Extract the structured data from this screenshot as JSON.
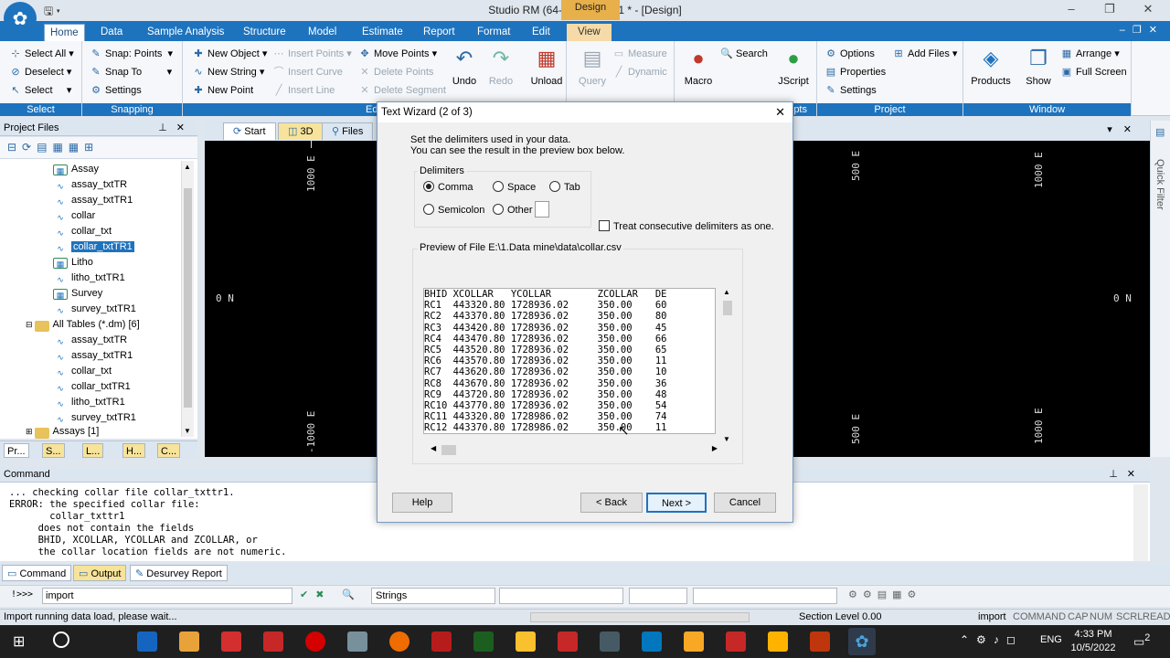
{
  "window": {
    "title": "Studio RM (64-bit) - aurum1 * - [Design]",
    "context_tab": "Design",
    "app_icon": "studio-rm-logo",
    "controls": [
      "–",
      "❐",
      "✕"
    ]
  },
  "ribbon": {
    "tabs": [
      "Home",
      "Data",
      "Sample Analysis",
      "Structure",
      "Model",
      "Estimate",
      "Report",
      "Format",
      "Edit",
      "View"
    ],
    "active_tab": "Home",
    "select_group": {
      "label": "Select",
      "select_all": "Select All",
      "deselect": "Deselect",
      "select": "Select"
    },
    "snapping_group": {
      "label": "Snapping",
      "snap_points": "Snap: Points",
      "snap_to": "Snap To",
      "settings": "Settings"
    },
    "edit_group": {
      "label": "Edit",
      "new_object": "New Object",
      "new_string": "New String",
      "new_point": "New Point",
      "insert_points": "Insert Points",
      "insert_curve": "Insert Curve",
      "insert_line": "Insert Line",
      "move_points": "Move Points",
      "delete_points": "Delete Points",
      "delete_segment": "Delete Segment",
      "undo": "Undo",
      "redo": "Redo",
      "unload": "Unload"
    },
    "query_group": {
      "query": "Query",
      "measure": "Measure",
      "dynamic": "Dynamic"
    },
    "scripts_group": {
      "label_fragment": "pts",
      "macro": "Macro",
      "search": "Search",
      "jscript": "JScript"
    },
    "project_group": {
      "label": "Project",
      "options": "Options",
      "add_files": "Add Files",
      "properties": "Properties",
      "settings": "Settings"
    },
    "window_group": {
      "label": "Window",
      "products": "Products",
      "show": "Show",
      "arrange": "Arrange",
      "full_screen": "Full Screen"
    }
  },
  "project_files": {
    "title": "Project Files",
    "tree": [
      {
        "label": "Assay",
        "type": "table"
      },
      {
        "label": "assay_txtTR",
        "type": "string"
      },
      {
        "label": "assay_txtTR1",
        "type": "string"
      },
      {
        "label": "collar",
        "type": "table"
      },
      {
        "label": "collar_txt",
        "type": "string"
      },
      {
        "label": "collar_txtTR1",
        "type": "string",
        "selected": true
      },
      {
        "label": "Litho",
        "type": "table"
      },
      {
        "label": "litho_txtTR1",
        "type": "string"
      },
      {
        "label": "Survey",
        "type": "table"
      },
      {
        "label": "survey_txtTR1",
        "type": "string"
      },
      {
        "label": "All Tables (*.dm) [6]",
        "type": "folder"
      },
      {
        "label": "assay_txtTR",
        "type": "string"
      },
      {
        "label": "assay_txtTR1",
        "type": "string"
      },
      {
        "label": "collar_txt",
        "type": "string"
      },
      {
        "label": "collar_txtTR1",
        "type": "string"
      },
      {
        "label": "litho_txtTR1",
        "type": "string"
      },
      {
        "label": "survey_txtTR1",
        "type": "string"
      },
      {
        "label": "Assays [1]",
        "type": "folder"
      }
    ],
    "bottom_tabs": [
      "Pr...",
      "S...",
      "L...",
      "H...",
      "C..."
    ]
  },
  "view": {
    "tabs": [
      "Start",
      "3D",
      "Files"
    ],
    "grid_labels": {
      "top_left": "1000 E",
      "top_mid": "500 E",
      "top_right": "1000 E",
      "bottom_left": "-1000 E",
      "bottom_mid": "500 E",
      "bottom_right": "1000 E",
      "left_north": "0 N",
      "right_north": "0 N"
    },
    "quick_filter": "Quick Filter"
  },
  "text_wizard": {
    "title": "Text Wizard (2 of 3)",
    "intro_line1": "Set the delimiters used in your data.",
    "intro_line2": "You can see the result in the preview box below.",
    "delimiters_label": "Delimiters",
    "options": {
      "comma": "Comma",
      "space": "Space",
      "tab": "Tab",
      "semicolon": "Semicolon",
      "other": "Other"
    },
    "selected": "comma",
    "treat_consecutive": "Treat consecutive delimiters as one.",
    "treat_consecutive_checked": false,
    "preview_label": "Preview of File E:\\1.Data mine\\data\\collar.csv",
    "preview_columns": [
      "BHID",
      "XCOLLAR",
      "YCOLLAR",
      "ZCOLLAR",
      "DE"
    ],
    "preview_rows": [
      [
        "RC1",
        "443320.80",
        "1728936.02",
        "350.00",
        "60"
      ],
      [
        "RC2",
        "443370.80",
        "1728936.02",
        "350.00",
        "80"
      ],
      [
        "RC3",
        "443420.80",
        "1728936.02",
        "350.00",
        "45"
      ],
      [
        "RC4",
        "443470.80",
        "1728936.02",
        "350.00",
        "66"
      ],
      [
        "RC5",
        "443520.80",
        "1728936.02",
        "350.00",
        "65"
      ],
      [
        "RC6",
        "443570.80",
        "1728936.02",
        "350.00",
        "11"
      ],
      [
        "RC7",
        "443620.80",
        "1728936.02",
        "350.00",
        "10"
      ],
      [
        "RC8",
        "443670.80",
        "1728936.02",
        "350.00",
        "36"
      ],
      [
        "RC9",
        "443720.80",
        "1728936.02",
        "350.00",
        "48"
      ],
      [
        "RC10",
        "443770.80",
        "1728936.02",
        "350.00",
        "54"
      ],
      [
        "RC11",
        "443320.80",
        "1728986.02",
        "350.00",
        "74"
      ],
      [
        "RC12",
        "443370.80",
        "1728986.02",
        "350.00",
        "11"
      ]
    ],
    "buttons": {
      "help": "Help",
      "back": "< Back",
      "next": "Next >",
      "cancel": "Cancel"
    }
  },
  "command": {
    "title": "Command",
    "output_lines": [
      "... checking collar file collar_txttr1.",
      "ERROR: the specified collar file:",
      "       collar_txttr1",
      "     does not contain the fields",
      "     BHID, XCOLLAR, YCOLLAR and ZCOLLAR, or",
      "     the collar location fields are not numeric."
    ],
    "tabs": [
      "Command",
      "Output",
      "Desurvey Report"
    ],
    "active_tab": "Output",
    "prompt": "!>>>",
    "input_value": "import",
    "strings_combo": "Strings"
  },
  "status": {
    "message": "Import running data load, please wait...",
    "section_level": "Section Level 0.00",
    "indicators": [
      "import",
      "COMMAND",
      "CAP",
      "NUM",
      "SCRL",
      "READ"
    ]
  },
  "taskbar": {
    "time": "4:33 PM",
    "date": "10/5/2022",
    "language": "ENG",
    "notification_count": "2"
  },
  "colors": {
    "accent": "#1e73be",
    "context_tab": "#e8b04a",
    "selection": "#1e73be",
    "viewport": "#000000"
  }
}
